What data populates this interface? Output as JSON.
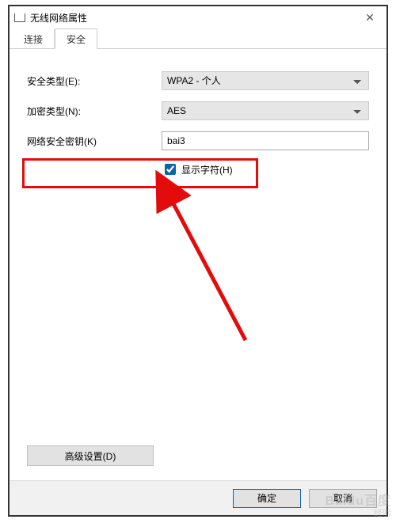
{
  "window": {
    "title": "无线网络属性"
  },
  "tabs": {
    "connect": "连接",
    "security": "安全"
  },
  "fields": {
    "security_type": {
      "label": "安全类型(E):",
      "value": "WPA2 - 个人"
    },
    "encryption_type": {
      "label": "加密类型(N):",
      "value": "AES"
    },
    "network_key": {
      "label": "网络安全密钥(K)",
      "value": "bai3"
    },
    "show_chars": {
      "label": "显示字符(H)",
      "checked": true
    }
  },
  "buttons": {
    "advanced": "高级设置(D)",
    "ok": "确定",
    "cancel": "取消"
  },
  "watermark": {
    "line1": "Baidu百度",
    "line2": "经验"
  }
}
